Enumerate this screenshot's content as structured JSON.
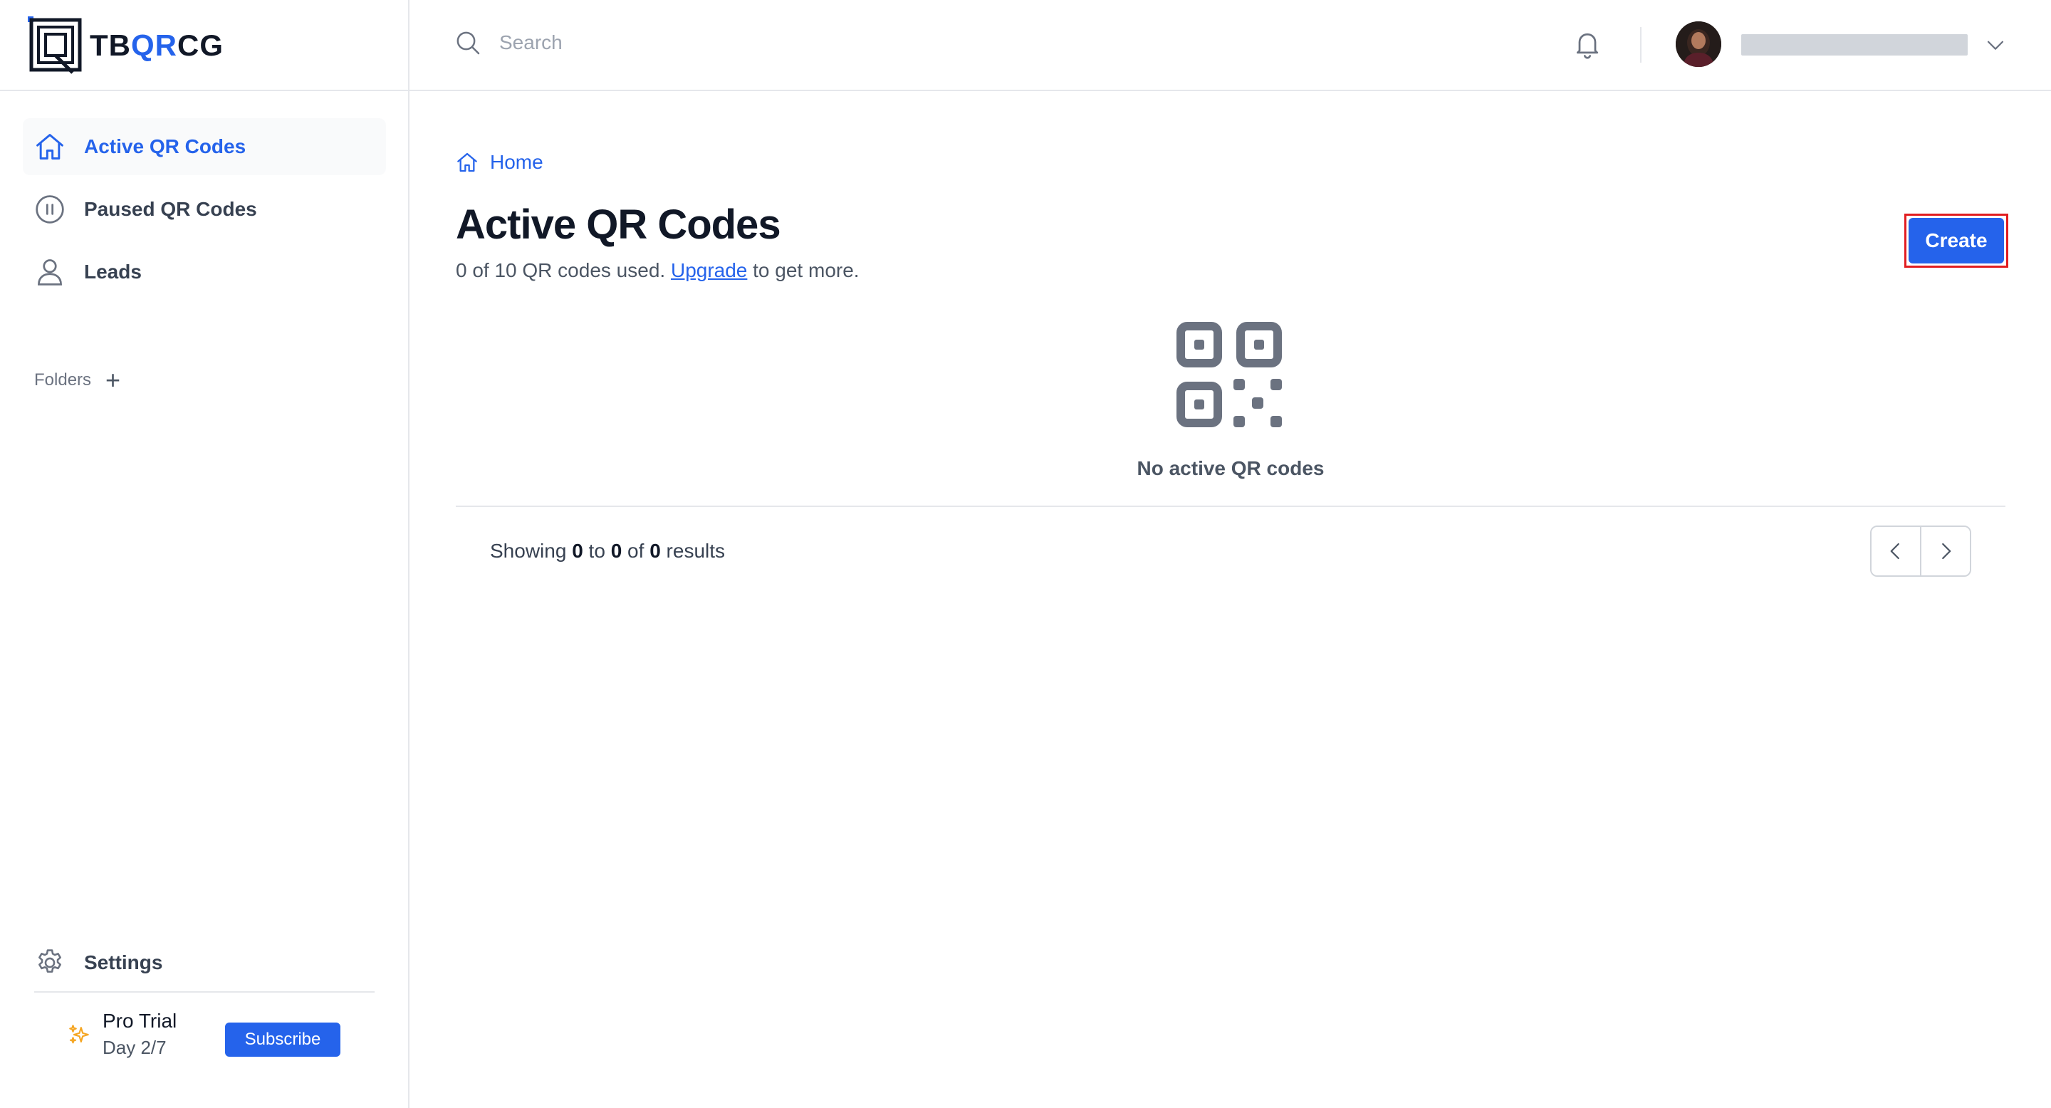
{
  "brand": {
    "prefix": "TB",
    "highlight": "QR",
    "suffix": "CG",
    "accent_color": "#2563eb"
  },
  "sidebar": {
    "items": [
      {
        "label": "Active QR Codes",
        "icon": "home-icon",
        "active": true
      },
      {
        "label": "Paused QR Codes",
        "icon": "pause-circle-icon",
        "active": false
      },
      {
        "label": "Leads",
        "icon": "user-icon",
        "active": false
      }
    ],
    "folders_label": "Folders",
    "folders_add": "+",
    "settings_label": "Settings",
    "trial": {
      "title": "Pro Trial",
      "day": "Day 2/7",
      "subscribe_label": "Subscribe"
    }
  },
  "topbar": {
    "search_placeholder": "Search"
  },
  "main": {
    "breadcrumb": "Home",
    "title": "Active QR Codes",
    "usage_prefix": "0 of 10 QR codes used. ",
    "usage_link": "Upgrade",
    "usage_suffix": " to get more.",
    "create_label": "Create",
    "empty_text": "No active QR codes",
    "pagination": {
      "showing": "Showing",
      "from": "0",
      "to_word": "to",
      "to": "0",
      "of_word": "of",
      "total": "0",
      "results_word": "results"
    }
  }
}
